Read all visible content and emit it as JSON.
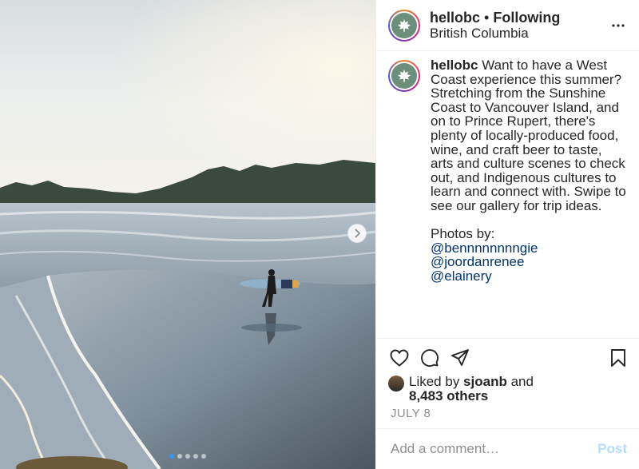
{
  "header": {
    "username": "hellobc",
    "separator": " • ",
    "follow_state": "Following",
    "location": "British Columbia"
  },
  "caption": {
    "username": "hellobc",
    "text": " Want to have a West Coast experience this summer? Stretching from the Sunshine Coast to Vancouver Island, and on to Prince Rupert, there's plenty of locally-produced food, wine, and craft beer to taste, arts and culture scenes to check out, and Indigenous cultures to learn and connect with. Swipe to see our gallery for trip ideas.",
    "photos_by_label": "Photos by:",
    "mentions": [
      "@bennnnnnnngie",
      "@joordanrenee",
      "@elainery"
    ]
  },
  "likes": {
    "prefix": "Liked by ",
    "user": "sjoanb",
    "middle": " and",
    "others": "8,483 others"
  },
  "post_date": "JULY 8",
  "comment": {
    "placeholder": "Add a comment…",
    "post_label": "Post"
  },
  "carousel": {
    "slide_count": 5,
    "active_index": 0
  },
  "colors": {
    "link": "#003569",
    "post_button_disabled": "#b2dffc",
    "active_dot": "#3897f0",
    "secondary_text": "#8e8e8e"
  },
  "icons": {
    "next": "chevron-right-icon",
    "more": "more-options-icon",
    "like": "heart-icon",
    "comment": "comment-icon",
    "share": "share-icon",
    "save": "bookmark-icon"
  }
}
